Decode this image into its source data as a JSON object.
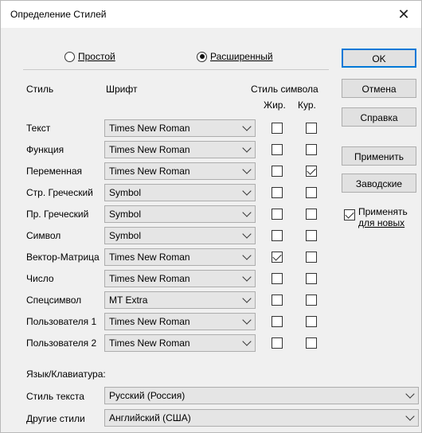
{
  "title": "Определение Стилей",
  "mode": {
    "simple_label": "Простой",
    "advanced_label": "Расширенный",
    "selected": "advanced"
  },
  "headers": {
    "style": "Стиль",
    "font": "Шрифт",
    "char_style": "Стиль символа",
    "bold": "Жир.",
    "italic": "Кур."
  },
  "rows": [
    {
      "label": "Текст",
      "font": "Times New Roman",
      "bold": false,
      "italic": false
    },
    {
      "label": "Функция",
      "font": "Times New Roman",
      "bold": false,
      "italic": false
    },
    {
      "label": "Переменная",
      "font": "Times New Roman",
      "bold": false,
      "italic": true
    },
    {
      "label": "Стр. Греческий",
      "font": "Symbol",
      "bold": false,
      "italic": false
    },
    {
      "label": "Пр. Греческий",
      "font": "Symbol",
      "bold": false,
      "italic": false
    },
    {
      "label": "Символ",
      "font": "Symbol",
      "bold": false,
      "italic": false
    },
    {
      "label": "Вектор-Матрица",
      "font": "Times New Roman",
      "bold": true,
      "italic": false
    },
    {
      "label": "Число",
      "font": "Times New Roman",
      "bold": false,
      "italic": false
    },
    {
      "label": "Спецсимвол",
      "font": "MT Extra",
      "bold": false,
      "italic": false
    },
    {
      "label": "Пользователя 1",
      "font": "Times New Roman",
      "bold": false,
      "italic": false
    },
    {
      "label": "Пользователя 2",
      "font": "Times New Roman",
      "bold": false,
      "italic": false
    }
  ],
  "buttons": {
    "ok": "OK",
    "cancel": "Отмена",
    "help": "Справка",
    "apply": "Применить",
    "factory": "Заводские"
  },
  "apply_new": {
    "line1": "Применять",
    "line2": "для новых",
    "checked": true
  },
  "language": {
    "section_label": "Язык/Клавиатура:",
    "text_style_label": "Стиль текста",
    "text_style_value": "Русский (Россия)",
    "other_label": "Другие стили",
    "other_value": "Английский (США)"
  }
}
